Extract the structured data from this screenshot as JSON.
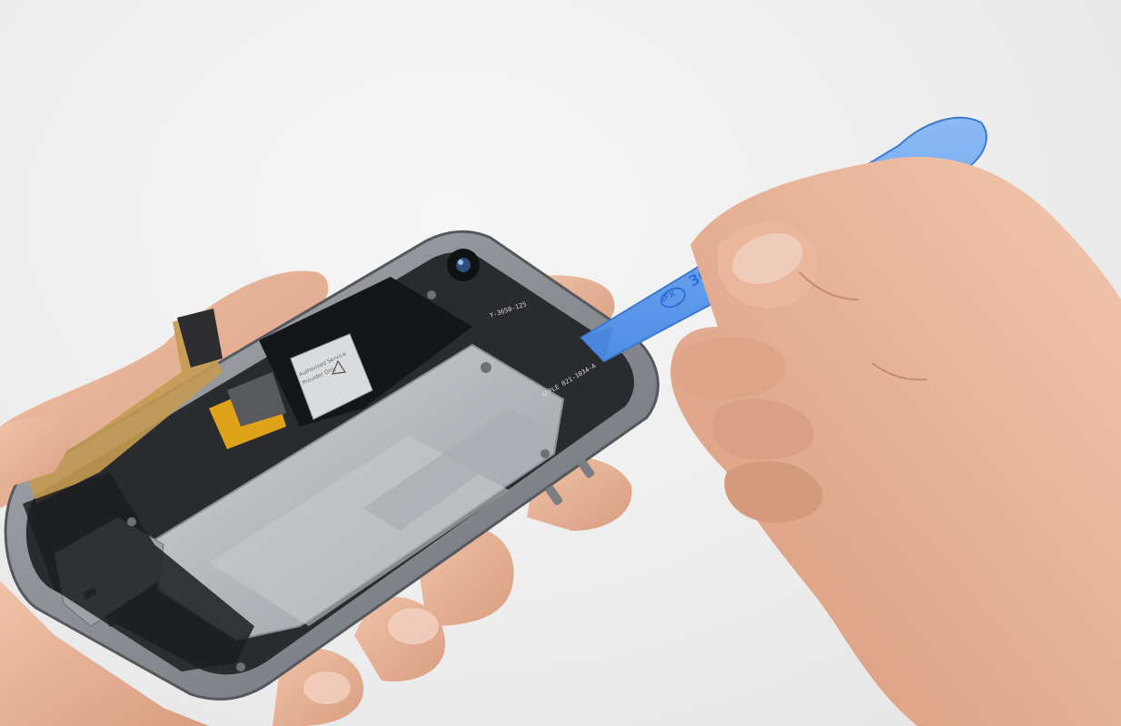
{
  "scene": {
    "description_tag": "photo",
    "colors": {
      "background": "#ececec",
      "skin": "#e9b49a",
      "skin_shadow": "#c98d72",
      "phone_frame": "#8d9096",
      "shield": "#b9bcc0",
      "board": "#1f2023",
      "spudger": "#6aa3ef",
      "ribbon": "#c49a52",
      "kapton": "#e0a21a"
    }
  },
  "spudger": {
    "brand_mark": "iFX",
    "number_text": "363"
  },
  "phone": {
    "chip_label": "Y-3650-125",
    "board_label": "APPLE 821-1034-A",
    "sticker_line1": "Authorized Service",
    "sticker_line2": "Provider Only"
  }
}
